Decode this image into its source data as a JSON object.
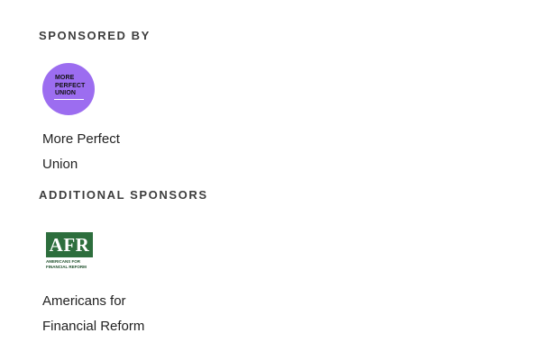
{
  "sections": {
    "sponsored_by": {
      "heading": "SPONSORED BY",
      "sponsor": {
        "logo": {
          "lines": [
            "MORE",
            "PERFECT",
            "UNION"
          ],
          "background": "#9c6df0"
        },
        "name_lines": [
          "More Perfect",
          "Union"
        ]
      }
    },
    "additional_sponsors": {
      "heading": "ADDITIONAL SPONSORS",
      "sponsor": {
        "logo": {
          "wordmark": "AFR",
          "sub_lines": [
            "AMERICANS FOR",
            "FINANCIAL REFORM"
          ],
          "background": "#2d6e3d"
        },
        "name_lines": [
          "Americans for",
          "Financial Reform"
        ]
      }
    }
  }
}
